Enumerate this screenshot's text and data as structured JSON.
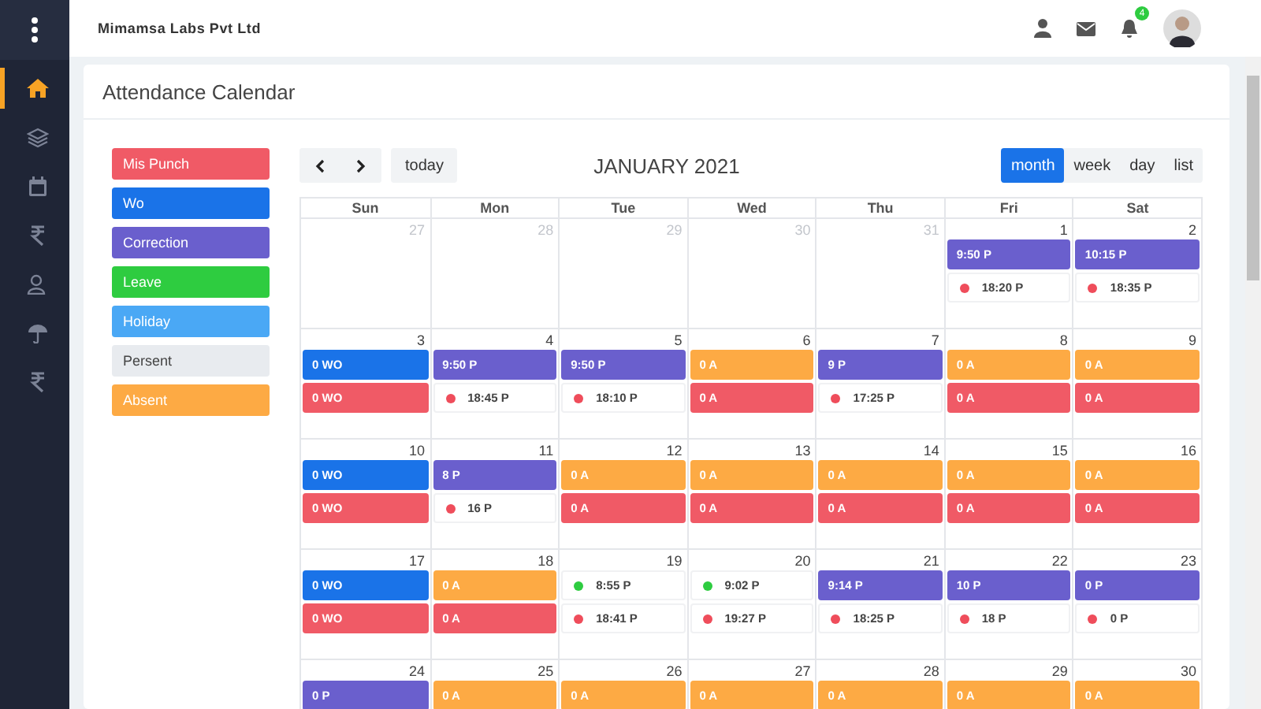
{
  "topbar": {
    "company": "Mimamsa Labs Pvt Ltd",
    "notification_count": "4"
  },
  "sidebar": {
    "items": [
      {
        "selected": true
      },
      {
        "selected": false
      },
      {
        "selected": false
      },
      {
        "selected": false
      },
      {
        "selected": false
      },
      {
        "selected": false
      },
      {
        "selected": false
      }
    ]
  },
  "page": {
    "title": "Attendance Calendar"
  },
  "legend": [
    {
      "kind": "mispunch",
      "label": "Mis Punch"
    },
    {
      "kind": "wo",
      "label": "Wo"
    },
    {
      "kind": "correction",
      "label": "Correction"
    },
    {
      "kind": "leave",
      "label": "Leave"
    },
    {
      "kind": "holiday",
      "label": "Holiday"
    },
    {
      "kind": "present",
      "label": "Persent"
    },
    {
      "kind": "absent",
      "label": "Absent"
    }
  ],
  "calendar": {
    "title": "JANUARY 2021",
    "today_label": "today",
    "views": [
      {
        "label": "month",
        "selected": true
      },
      {
        "label": "week",
        "selected": false
      },
      {
        "label": "day",
        "selected": false
      },
      {
        "label": "list",
        "selected": false
      }
    ],
    "weekdays": [
      "Sun",
      "Mon",
      "Tue",
      "Wed",
      "Thu",
      "Fri",
      "Sat"
    ],
    "weeks": [
      {
        "days": [
          {
            "date": "27",
            "muted": true
          },
          {
            "date": "28",
            "muted": true
          },
          {
            "date": "29",
            "muted": true
          },
          {
            "date": "30",
            "muted": true
          },
          {
            "date": "31",
            "muted": true
          },
          {
            "date": "1",
            "muted": false,
            "events": [
              {
                "kind": "correction",
                "label": "9:50 P"
              },
              {
                "kind": "punch",
                "label": "18:20 P",
                "color": "#ef4d5b"
              }
            ]
          },
          {
            "date": "2",
            "muted": false,
            "events": [
              {
                "kind": "correction",
                "label": "10:15 P"
              },
              {
                "kind": "punch",
                "label": "18:35 P",
                "color": "#ef4d5b"
              }
            ]
          }
        ]
      },
      {
        "days": [
          {
            "date": "3",
            "muted": false,
            "events": [
              {
                "kind": "wo",
                "label": "0 WO"
              },
              {
                "kind": "mispunch",
                "label": "0 WO"
              }
            ]
          },
          {
            "date": "4",
            "muted": false,
            "events": [
              {
                "kind": "correction",
                "label": "9:50 P"
              },
              {
                "kind": "punch",
                "label": "18:45 P",
                "color": "#ef4d5b"
              }
            ]
          },
          {
            "date": "5",
            "muted": false,
            "events": [
              {
                "kind": "correction",
                "label": "9:50 P"
              },
              {
                "kind": "punch",
                "label": "18:10 P",
                "color": "#ef4d5b"
              }
            ]
          },
          {
            "date": "6",
            "muted": false,
            "events": [
              {
                "kind": "absent",
                "label": "0 A"
              },
              {
                "kind": "mispunch",
                "label": "0 A"
              }
            ]
          },
          {
            "date": "7",
            "muted": false,
            "events": [
              {
                "kind": "correction",
                "label": "9 P"
              },
              {
                "kind": "punch",
                "label": "17:25 P",
                "color": "#ef4d5b"
              }
            ]
          },
          {
            "date": "8",
            "muted": false,
            "events": [
              {
                "kind": "absent",
                "label": "0 A"
              },
              {
                "kind": "mispunch",
                "label": "0 A"
              }
            ]
          },
          {
            "date": "9",
            "muted": false,
            "events": [
              {
                "kind": "absent",
                "label": "0 A"
              },
              {
                "kind": "mispunch",
                "label": "0 A"
              }
            ]
          }
        ]
      },
      {
        "days": [
          {
            "date": "10",
            "muted": false,
            "events": [
              {
                "kind": "wo",
                "label": "0 WO"
              },
              {
                "kind": "mispunch",
                "label": "0 WO"
              }
            ]
          },
          {
            "date": "11",
            "muted": false,
            "events": [
              {
                "kind": "correction",
                "label": "8 P"
              },
              {
                "kind": "punch",
                "label": "16 P",
                "color": "#ef4d5b"
              }
            ]
          },
          {
            "date": "12",
            "muted": false,
            "events": [
              {
                "kind": "absent",
                "label": "0 A"
              },
              {
                "kind": "mispunch",
                "label": "0 A"
              }
            ]
          },
          {
            "date": "13",
            "muted": false,
            "events": [
              {
                "kind": "absent",
                "label": "0 A"
              },
              {
                "kind": "mispunch",
                "label": "0 A"
              }
            ]
          },
          {
            "date": "14",
            "muted": false,
            "events": [
              {
                "kind": "absent",
                "label": "0 A"
              },
              {
                "kind": "mispunch",
                "label": "0 A"
              }
            ]
          },
          {
            "date": "15",
            "muted": false,
            "events": [
              {
                "kind": "absent",
                "label": "0 A"
              },
              {
                "kind": "mispunch",
                "label": "0 A"
              }
            ]
          },
          {
            "date": "16",
            "muted": false,
            "events": [
              {
                "kind": "absent",
                "label": "0 A"
              },
              {
                "kind": "mispunch",
                "label": "0 A"
              }
            ]
          }
        ]
      },
      {
        "days": [
          {
            "date": "17",
            "muted": false,
            "events": [
              {
                "kind": "wo",
                "label": "0 WO"
              },
              {
                "kind": "mispunch",
                "label": "0 WO"
              }
            ]
          },
          {
            "date": "18",
            "muted": false,
            "events": [
              {
                "kind": "absent",
                "label": "0 A"
              },
              {
                "kind": "mispunch",
                "label": "0 A"
              }
            ]
          },
          {
            "date": "19",
            "muted": false,
            "events": [
              {
                "kind": "punch",
                "label": "8:55 P",
                "color": "#2ecc40"
              },
              {
                "kind": "punch",
                "label": "18:41 P",
                "color": "#ef4d5b"
              }
            ]
          },
          {
            "date": "20",
            "muted": false,
            "events": [
              {
                "kind": "punch",
                "label": "9:02 P",
                "color": "#2ecc40"
              },
              {
                "kind": "punch",
                "label": "19:27 P",
                "color": "#ef4d5b"
              }
            ]
          },
          {
            "date": "21",
            "muted": false,
            "events": [
              {
                "kind": "correction",
                "label": "9:14 P"
              },
              {
                "kind": "punch",
                "label": "18:25 P",
                "color": "#ef4d5b"
              }
            ]
          },
          {
            "date": "22",
            "muted": false,
            "events": [
              {
                "kind": "correction",
                "label": "10 P"
              },
              {
                "kind": "punch",
                "label": "18 P",
                "color": "#ef4d5b"
              }
            ]
          },
          {
            "date": "23",
            "muted": false,
            "events": [
              {
                "kind": "correction",
                "label": "0 P"
              },
              {
                "kind": "punch",
                "label": "0 P",
                "color": "#ef4d5b"
              }
            ]
          }
        ]
      },
      {
        "days": [
          {
            "date": "24",
            "muted": false,
            "events": [
              {
                "kind": "correction",
                "label": "0 P"
              }
            ]
          },
          {
            "date": "25",
            "muted": false,
            "events": [
              {
                "kind": "absent",
                "label": "0 A"
              }
            ]
          },
          {
            "date": "26",
            "muted": false,
            "events": [
              {
                "kind": "absent",
                "label": "0 A"
              }
            ]
          },
          {
            "date": "27",
            "muted": false,
            "events": [
              {
                "kind": "absent",
                "label": "0 A"
              }
            ]
          },
          {
            "date": "28",
            "muted": false,
            "events": [
              {
                "kind": "absent",
                "label": "0 A"
              }
            ]
          },
          {
            "date": "29",
            "muted": false,
            "events": [
              {
                "kind": "absent",
                "label": "0 A"
              }
            ]
          },
          {
            "date": "30",
            "muted": false,
            "events": [
              {
                "kind": "absent",
                "label": "0 A"
              }
            ]
          }
        ]
      }
    ]
  }
}
